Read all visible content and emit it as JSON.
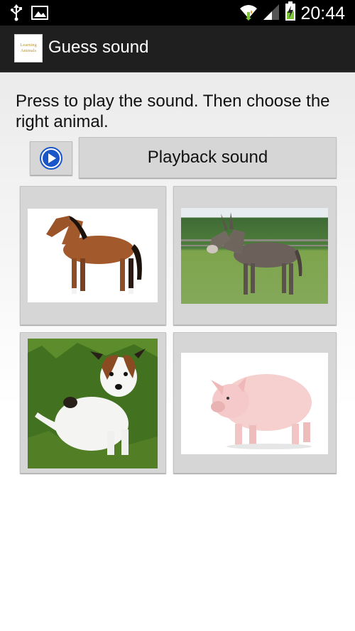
{
  "status_bar": {
    "time": "20:44",
    "icons": [
      "usb-icon",
      "image-icon",
      "wifi-icon",
      "signal-icon",
      "battery-charging-icon"
    ]
  },
  "action_bar": {
    "app_icon_text_line1": "Learning",
    "app_icon_text_line2": "Animals",
    "title": "Guess sound"
  },
  "main": {
    "instructions": "Press to play the sound. Then choose the right animal.",
    "play_icon": "play-circle-icon",
    "playback_label": "Playback sound",
    "animals": [
      {
        "name": "horse",
        "background": "white"
      },
      {
        "name": "donkey",
        "background": "field"
      },
      {
        "name": "dog",
        "background": "grass"
      },
      {
        "name": "pig",
        "background": "white"
      }
    ]
  },
  "colors": {
    "status_bar": "#000000",
    "action_bar": "#1f1f1f",
    "button": "#d6d6d6",
    "play_icon_blue": "#1a56c8"
  }
}
